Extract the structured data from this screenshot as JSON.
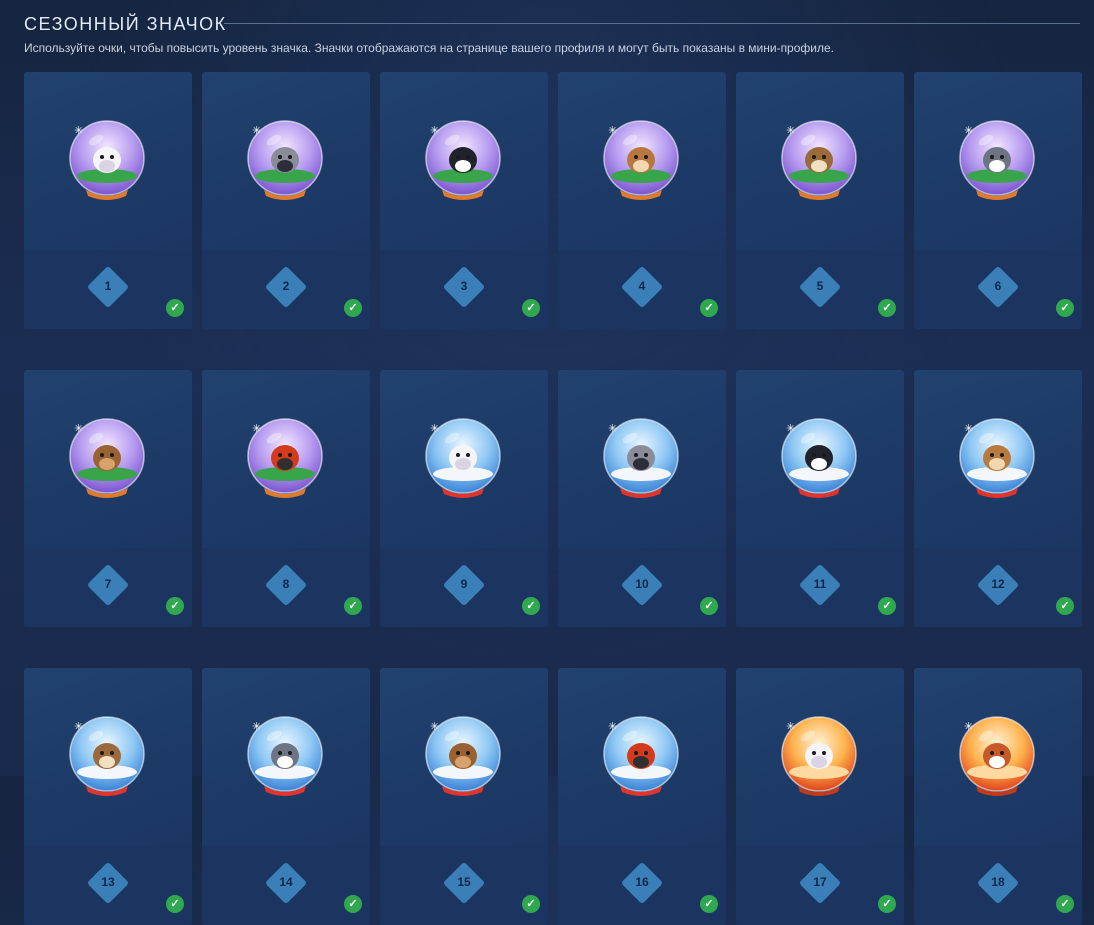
{
  "section": {
    "title": "Сезонный значок",
    "description": "Используйте очки, чтобы повысить уровень значка. Значки отображаются на странице вашего профиля и могут быть показаны в мини-профиле."
  },
  "badges": [
    {
      "level": "1",
      "animal": "bunny",
      "style": "purple-snowglobe",
      "completed": true
    },
    {
      "level": "2",
      "animal": "raccoon",
      "style": "purple-snowglobe",
      "completed": true
    },
    {
      "level": "3",
      "animal": "penguin",
      "style": "purple-snowglobe",
      "completed": true
    },
    {
      "level": "4",
      "animal": "fawn",
      "style": "purple-snowglobe",
      "completed": true
    },
    {
      "level": "5",
      "animal": "owl",
      "style": "purple-snowglobe",
      "completed": true
    },
    {
      "level": "6",
      "animal": "husky",
      "style": "purple-snowglobe",
      "completed": true
    },
    {
      "level": "7",
      "animal": "bear",
      "style": "purple-snowglobe",
      "completed": true
    },
    {
      "level": "8",
      "animal": "gnome",
      "style": "purple-snowglobe",
      "completed": true
    },
    {
      "level": "9",
      "animal": "bunny",
      "style": "blue-snowglobe",
      "completed": true
    },
    {
      "level": "10",
      "animal": "raccoon",
      "style": "blue-snowglobe",
      "completed": true
    },
    {
      "level": "11",
      "animal": "penguin",
      "style": "blue-snowglobe",
      "completed": true
    },
    {
      "level": "12",
      "animal": "deer",
      "style": "blue-snowglobe",
      "completed": true
    },
    {
      "level": "13",
      "animal": "owl",
      "style": "blue-snowglobe",
      "completed": true
    },
    {
      "level": "14",
      "animal": "husky",
      "style": "blue-snowglobe",
      "completed": true
    },
    {
      "level": "15",
      "animal": "bear",
      "style": "blue-snowglobe",
      "completed": true
    },
    {
      "level": "16",
      "animal": "gnome",
      "style": "blue-snowglobe",
      "completed": true
    },
    {
      "level": "17",
      "animal": "bunny",
      "style": "fire-snowglobe",
      "completed": true
    },
    {
      "level": "18",
      "animal": "red-panda",
      "style": "fire-snowglobe",
      "completed": true
    }
  ],
  "colors": {
    "card": "#1d3863",
    "level_diamond": "#3a7fb8",
    "check": "#2fa84f",
    "purple_globe": "#8d6fd8",
    "blue_globe": "#3c8fe0",
    "fire_globe": "#ff8a3a"
  },
  "icons": {
    "completed": "check-circle-icon",
    "sparkle": "sparkle-icon"
  }
}
